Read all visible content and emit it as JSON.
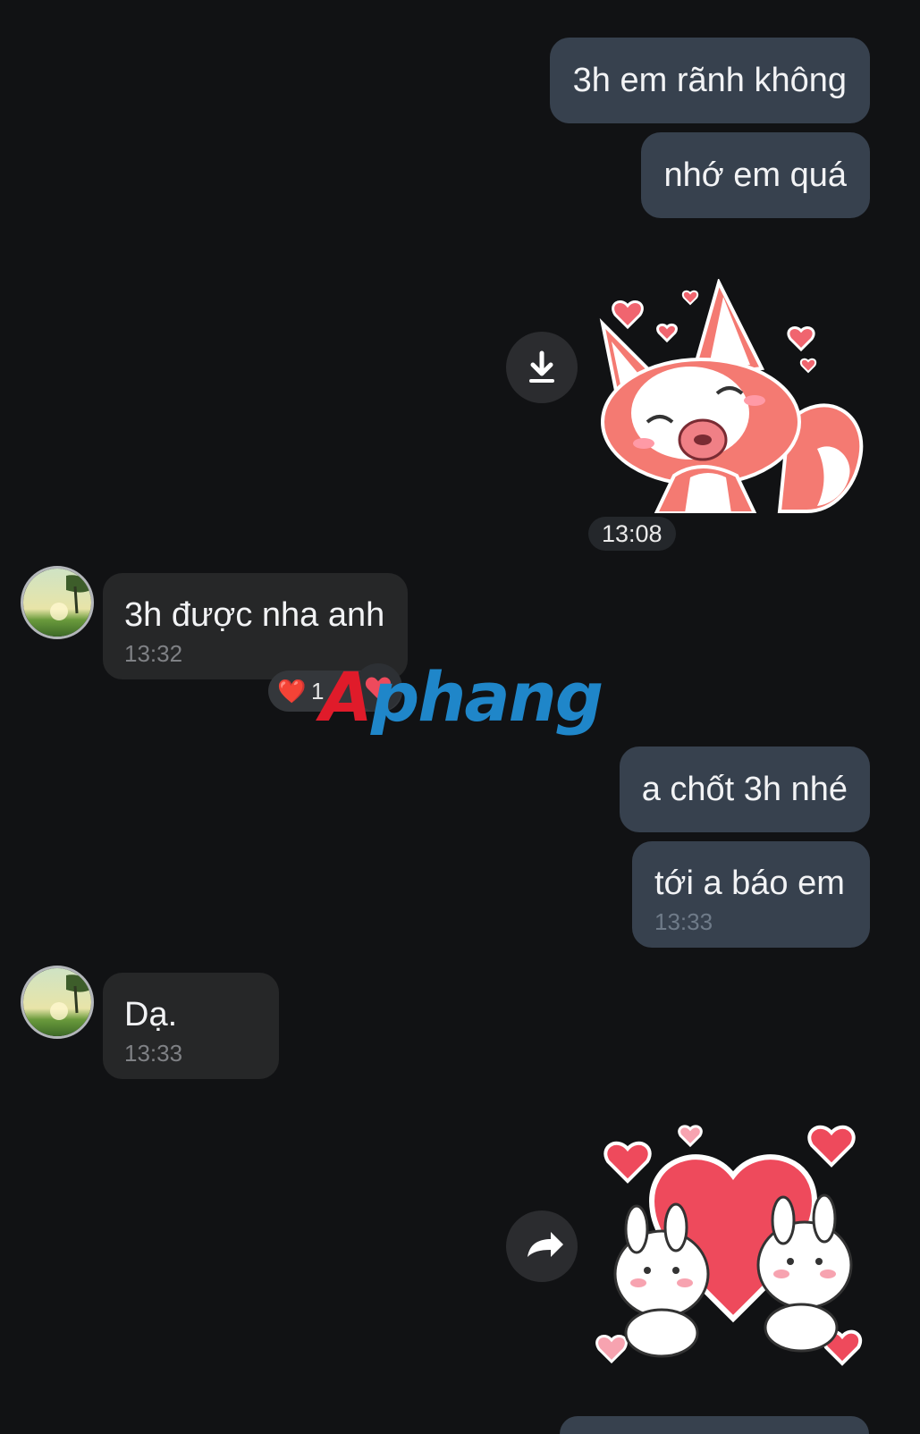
{
  "messages": {
    "m1": {
      "text": "3h em rãnh không"
    },
    "m2": {
      "text": "nhớ em quá"
    },
    "sticker1": {
      "name": "fox-kiss-sticker",
      "time": "13:08"
    },
    "m3": {
      "text": "3h được nha anh",
      "time": "13:32"
    },
    "reaction": {
      "emoji": "❤️",
      "count": "1"
    },
    "m4": {
      "text": "a chốt 3h nhé"
    },
    "m5": {
      "text": "tới a báo em",
      "time": "13:33"
    },
    "m6": {
      "text": "Dạ.",
      "time": "13:33"
    },
    "sticker2": {
      "name": "bunnies-heart-sticker"
    }
  },
  "watermark": {
    "part1": "A",
    "part2": "phang"
  },
  "icons": {
    "download": "download-icon",
    "forward": "forward-arrow-icon",
    "avatar": "landscape-avatar"
  },
  "colors": {
    "background": "#111214",
    "outgoing_bubble": "#37414e",
    "incoming_bubble": "#262728",
    "accent_heart": "#ee4a5c",
    "watermark_red": "#e01b2a",
    "watermark_blue": "#1f86c9"
  }
}
